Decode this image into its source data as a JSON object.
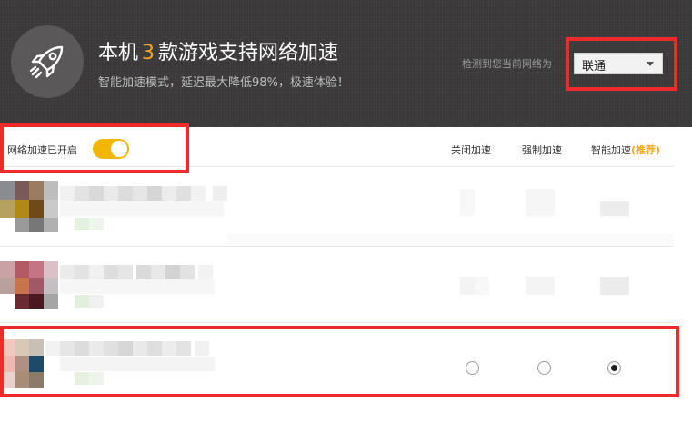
{
  "header": {
    "title_prefix": "本机",
    "title_count": "3",
    "title_suffix": "款游戏支持网络加速",
    "subtitle": "智能加速模式，延迟最大降低98%，极速体验！",
    "network_label": "检测到您当前网络为",
    "network_value": "联通"
  },
  "toolbar": {
    "acceleration_label": "网络加速已开启",
    "acceleration_on": true,
    "columns": {
      "off": "关闭加速",
      "forced": "强制加速",
      "smart": "智能加速",
      "smart_tag": "(推荐)"
    }
  },
  "games": [
    {
      "selected_mode": null
    },
    {
      "selected_mode": null
    },
    {
      "selected_mode": "smart"
    }
  ],
  "colors": {
    "accent": "#f5a623",
    "toggle": "#f2b705",
    "header_bg": "#3a3838",
    "annotation": "#ee2b2b"
  },
  "icons": {
    "logo": "rocket-icon",
    "dropdown": "chevron-down-icon"
  }
}
